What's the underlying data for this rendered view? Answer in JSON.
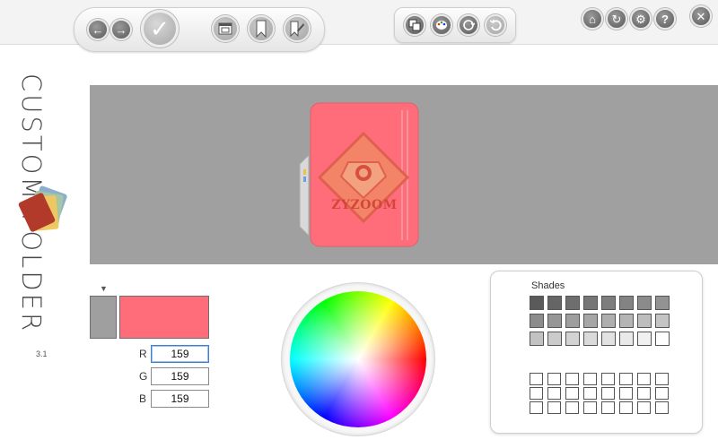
{
  "toolbar": {
    "main_buttons": [
      {
        "icon": "back-arrow-icon",
        "glyph": "←"
      },
      {
        "icon": "forward-arrow-icon",
        "glyph": "→"
      },
      {
        "icon": "checkmark-icon",
        "glyph": "✓"
      },
      {
        "icon": "window-icon",
        "glyph": ""
      },
      {
        "icon": "bookmark-icon",
        "glyph": ""
      },
      {
        "icon": "edit-tag-icon",
        "glyph": ""
      }
    ],
    "tool_buttons": [
      {
        "icon": "copy-icon"
      },
      {
        "icon": "palette-icon"
      },
      {
        "icon": "shuffle-icon"
      },
      {
        "icon": "undo-icon"
      }
    ],
    "right_buttons": [
      {
        "icon": "home-icon",
        "glyph": "⌂"
      },
      {
        "icon": "refresh-icon",
        "glyph": "↻"
      },
      {
        "icon": "gear-icon",
        "glyph": "⚙"
      },
      {
        "icon": "help-icon",
        "glyph": "?"
      }
    ],
    "close_glyph": "✕"
  },
  "sidebar": {
    "title_top": "CUSTOM",
    "title_bottom": "FOLDER",
    "version": "3.1"
  },
  "preview": {
    "folder_color": "#ff6d7a",
    "emblem_text": "ZYZOOM"
  },
  "color_picker": {
    "marker": "▼",
    "old_color": "#9f9f9f",
    "new_color": "#ff6d7a",
    "r_label": "R",
    "g_label": "G",
    "b_label": "B",
    "r_value": "159",
    "g_value": "159",
    "b_value": "159"
  },
  "shades": {
    "title": "Shades",
    "rows": [
      [
        "#5a5a5a",
        "#656565",
        "#6e6e6e",
        "#767676",
        "#7d7d7d",
        "#838383",
        "#8b8b8b",
        "#939393"
      ],
      [
        "#8c8c8c",
        "#969696",
        "#9e9e9e",
        "#a6a6a6",
        "#aeaeae",
        "#b5b5b5",
        "#bdbdbd",
        "#c4c4c4"
      ],
      [
        "#c2c2c2",
        "#cbcbcb",
        "#d3d3d3",
        "#dadada",
        "#e2e2e2",
        "#e9e9e9",
        "#f1f1f1",
        "#ffffff"
      ]
    ],
    "custom_rows": 3,
    "custom_cols": 8
  }
}
